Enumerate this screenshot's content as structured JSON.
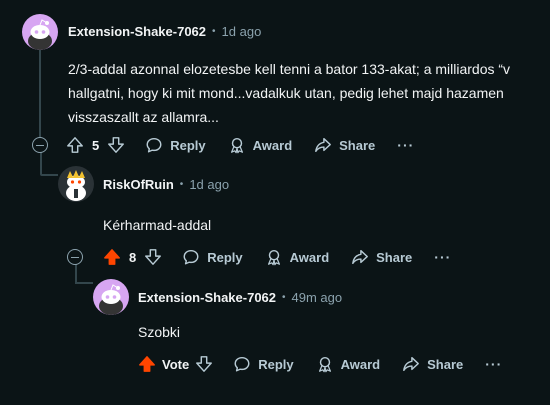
{
  "comments": [
    {
      "author": "Extension-Shake-7062",
      "separator": "•",
      "time": "1d ago",
      "lines": [
        "2/3-addal azonnal elozetesbe kell tenni a bator 133-akat; a milliardos “v",
        "hallgatni, hogy ki mit mond...vadalkuk utan, pedig lehet majd hazamen",
        "visszaszallt az allamra..."
      ],
      "score": "5",
      "reply": "Reply",
      "award": "Award",
      "share": "Share",
      "more": "···"
    },
    {
      "author": "RiskOfRuin",
      "separator": "•",
      "time": "1d ago",
      "text": "Kérharmad-addal",
      "score": "8",
      "reply": "Reply",
      "award": "Award",
      "share": "Share",
      "more": "···"
    },
    {
      "author": "Extension-Shake-7062",
      "separator": "•",
      "time": "49m ago",
      "text": "Szobki",
      "vote_label": "Vote",
      "reply": "Reply",
      "award": "Award",
      "share": "Share",
      "more": "···"
    }
  ],
  "colors": {
    "background": "#0b1416",
    "upvoted": "#ff4500",
    "muted": "#8ba2ad",
    "avatar_purple": "#d7a6f2"
  }
}
